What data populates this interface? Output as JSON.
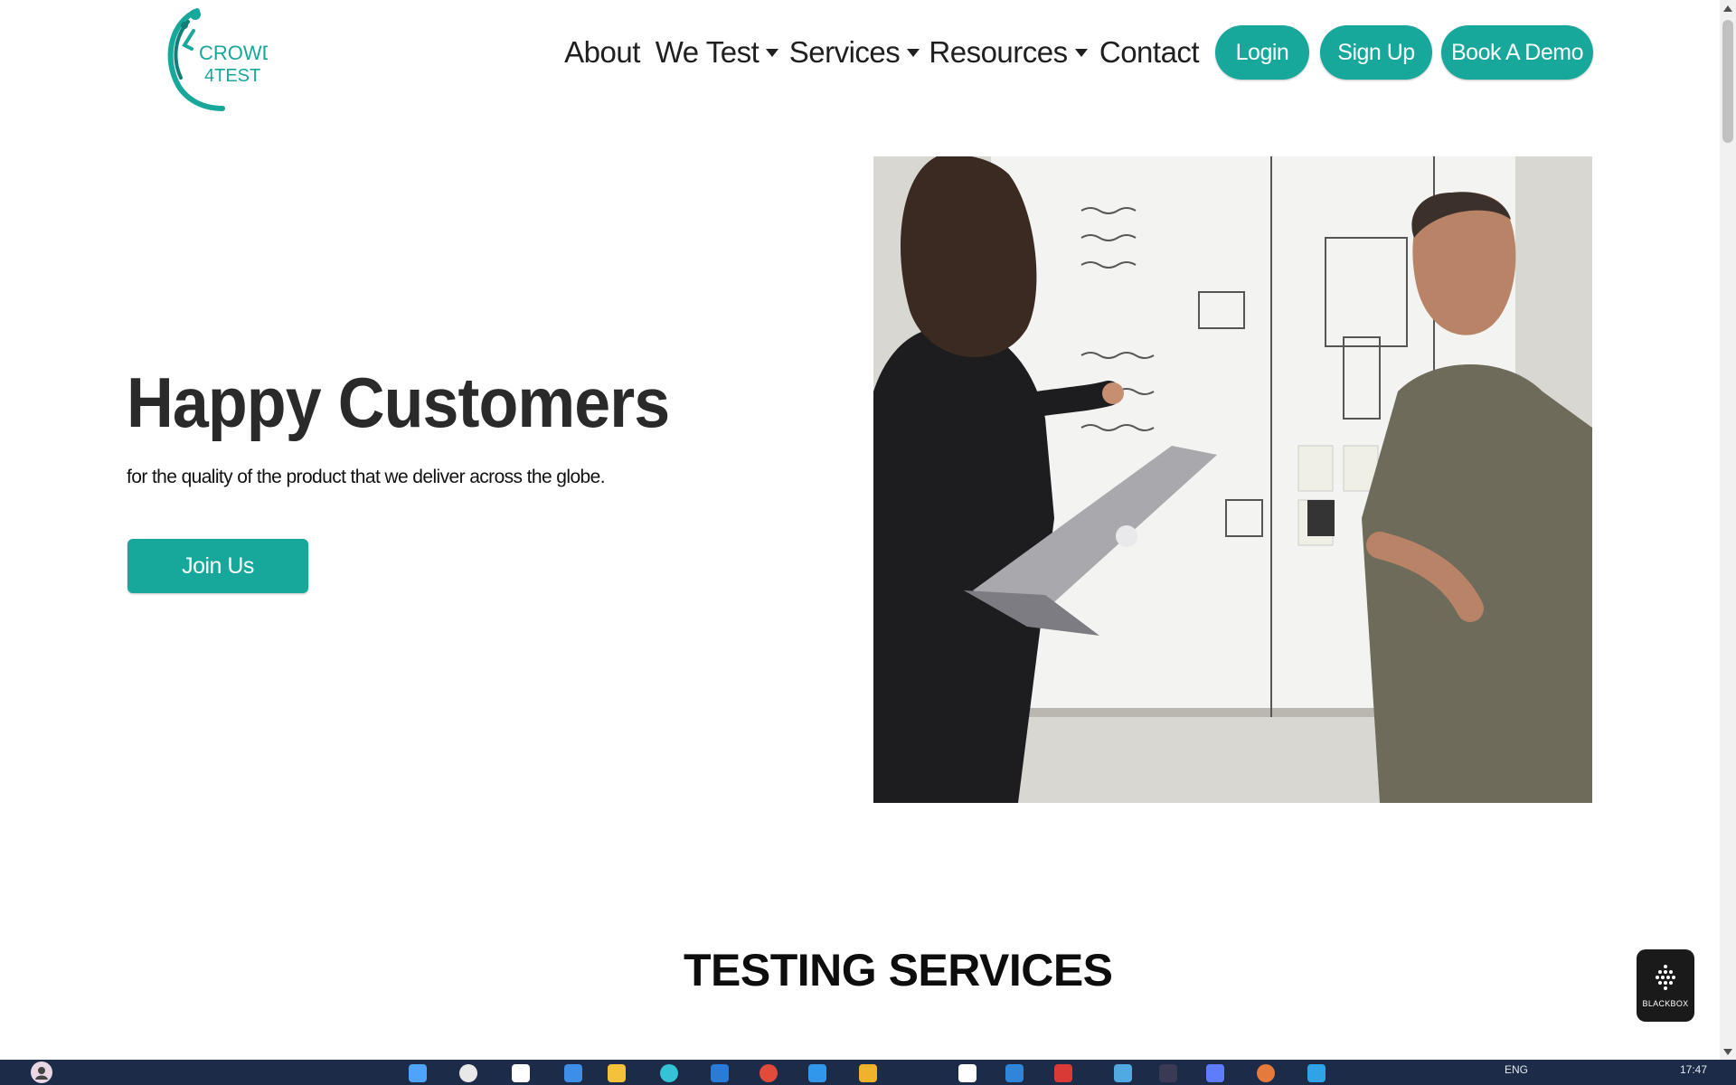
{
  "brand": {
    "logo_line1": "CROWD",
    "logo_line2": "4TEST",
    "accent": "#17a79b"
  },
  "nav": {
    "items": [
      {
        "label": "About",
        "dropdown": false
      },
      {
        "label": "We Test",
        "dropdown": true
      },
      {
        "label": "Services",
        "dropdown": true
      },
      {
        "label": "Resources",
        "dropdown": true
      },
      {
        "label": "Contact",
        "dropdown": false
      }
    ],
    "buttons": {
      "login": "Login",
      "signup": "Sign Up",
      "demo": "Book A Demo"
    }
  },
  "hero": {
    "title": "Happy Customers",
    "subtitle": "for the quality of the product that we deliver across the globe.",
    "cta": "Join Us"
  },
  "section": {
    "title": "TESTING SERVICES"
  },
  "widget": {
    "label": "BLACKBOX"
  },
  "taskbar": {
    "lang": "ENG",
    "time": "17:47"
  }
}
